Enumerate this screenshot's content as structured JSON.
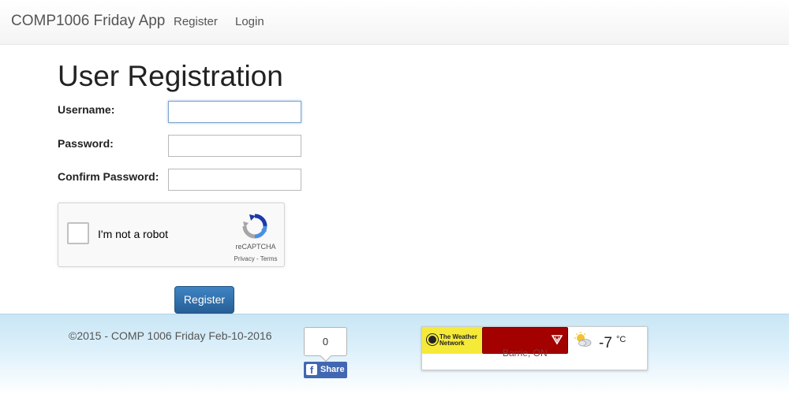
{
  "navbar": {
    "brand": "COMP1006 Friday App",
    "links": [
      "Register",
      "Login"
    ]
  },
  "page": {
    "title": "User Registration",
    "fields": {
      "username_label": "Username:",
      "username_value": "",
      "password_label": "Password:",
      "password_value": "",
      "confirm_label": "Confirm Password:",
      "confirm_value": ""
    },
    "recaptcha": {
      "label": "I'm not a robot",
      "brand": "reCAPTCHA",
      "links": "Privacy - Terms"
    },
    "register_button": "Register"
  },
  "footer": {
    "copyright": "©2015 - COMP 1006 Friday Feb-10-2016",
    "facebook": {
      "count": "0",
      "share_label": "Share"
    },
    "weather": {
      "logo_text": [
        "The Weather",
        "Network"
      ],
      "location": "Barrie, ON",
      "temperature": "-7",
      "unit": "°C",
      "condition_icon": "sun-cloud-icon"
    }
  },
  "colors": {
    "primary_button": "#337ab7",
    "facebook": "#4267b2",
    "weather_brand": "#f6ea38",
    "weather_location_bar": "#a30000"
  }
}
